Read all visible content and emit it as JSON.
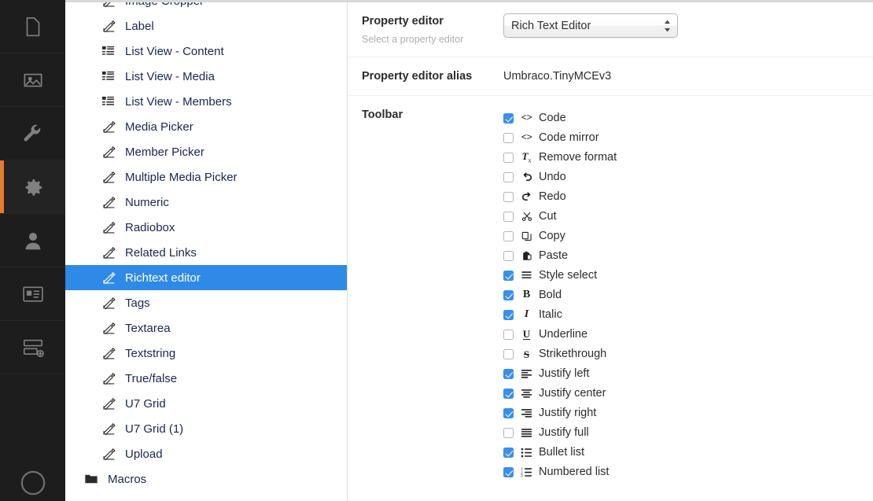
{
  "rail": {
    "items": [
      {
        "name": "content",
        "icon": "document-icon",
        "active": false
      },
      {
        "name": "media",
        "icon": "image-icon",
        "active": false
      },
      {
        "name": "settings-developer",
        "icon": "wrench-icon",
        "active": false
      },
      {
        "name": "settings",
        "icon": "gear-icon",
        "active": true
      },
      {
        "name": "users",
        "icon": "user-icon",
        "active": false
      },
      {
        "name": "members",
        "icon": "member-card-icon",
        "active": false
      },
      {
        "name": "forms",
        "icon": "forms-icon",
        "active": false
      }
    ],
    "bottom": {
      "name": "help",
      "icon": "help-circle-icon"
    },
    "active_indicator_color": "#e8792e"
  },
  "tree": {
    "selected": "Richtext editor",
    "selected_color": "#2e8ae6",
    "items": [
      {
        "label": "Image Cropper",
        "icon": "property-editor-icon",
        "type": "editor"
      },
      {
        "label": "Label",
        "icon": "property-editor-icon",
        "type": "editor"
      },
      {
        "label": "List View - Content",
        "icon": "list-view-icon",
        "type": "listview"
      },
      {
        "label": "List View - Media",
        "icon": "list-view-icon",
        "type": "listview"
      },
      {
        "label": "List View - Members",
        "icon": "list-view-icon",
        "type": "listview"
      },
      {
        "label": "Media Picker",
        "icon": "property-editor-icon",
        "type": "editor"
      },
      {
        "label": "Member Picker",
        "icon": "property-editor-icon",
        "type": "editor"
      },
      {
        "label": "Multiple Media Picker",
        "icon": "property-editor-icon",
        "type": "editor"
      },
      {
        "label": "Numeric",
        "icon": "property-editor-icon",
        "type": "editor"
      },
      {
        "label": "Radiobox",
        "icon": "property-editor-icon",
        "type": "editor"
      },
      {
        "label": "Related Links",
        "icon": "property-editor-icon",
        "type": "editor"
      },
      {
        "label": "Richtext editor",
        "icon": "property-editor-icon",
        "type": "editor"
      },
      {
        "label": "Tags",
        "icon": "property-editor-icon",
        "type": "editor"
      },
      {
        "label": "Textarea",
        "icon": "property-editor-icon",
        "type": "editor"
      },
      {
        "label": "Textstring",
        "icon": "property-editor-icon",
        "type": "editor"
      },
      {
        "label": "True/false",
        "icon": "property-editor-icon",
        "type": "editor"
      },
      {
        "label": "U7 Grid",
        "icon": "property-editor-icon",
        "type": "editor"
      },
      {
        "label": "U7 Grid (1)",
        "icon": "property-editor-icon",
        "type": "editor"
      },
      {
        "label": "Upload",
        "icon": "property-editor-icon",
        "type": "editor"
      },
      {
        "label": "Macros",
        "icon": "folder-icon",
        "type": "folder"
      }
    ]
  },
  "editor": {
    "property_editor": {
      "title": "Property editor",
      "description": "Select a property editor",
      "selected": "Rich Text Editor",
      "options": [
        "Rich Text Editor"
      ]
    },
    "alias": {
      "title": "Property editor alias",
      "value": "Umbraco.TinyMCEv3"
    },
    "toolbar": {
      "title": "Toolbar",
      "checked_color": "#3a8fea",
      "items": [
        {
          "label": "Code",
          "icon": "code-icon",
          "checked": true
        },
        {
          "label": "Code mirror",
          "icon": "code-icon",
          "checked": false
        },
        {
          "label": "Remove format",
          "icon": "remove-format-icon",
          "checked": false
        },
        {
          "label": "Undo",
          "icon": "undo-icon",
          "checked": false
        },
        {
          "label": "Redo",
          "icon": "redo-icon",
          "checked": false
        },
        {
          "label": "Cut",
          "icon": "scissors-icon",
          "checked": false
        },
        {
          "label": "Copy",
          "icon": "copy-icon",
          "checked": false
        },
        {
          "label": "Paste",
          "icon": "paste-icon",
          "checked": false
        },
        {
          "label": "Style select",
          "icon": "style-select-icon",
          "checked": true
        },
        {
          "label": "Bold",
          "icon": "bold-icon",
          "checked": true
        },
        {
          "label": "Italic",
          "icon": "italic-icon",
          "checked": true
        },
        {
          "label": "Underline",
          "icon": "underline-icon",
          "checked": false
        },
        {
          "label": "Strikethrough",
          "icon": "strikethrough-icon",
          "checked": false
        },
        {
          "label": "Justify left",
          "icon": "align-left-icon",
          "checked": true
        },
        {
          "label": "Justify center",
          "icon": "align-center-icon",
          "checked": true
        },
        {
          "label": "Justify right",
          "icon": "align-right-icon",
          "checked": true
        },
        {
          "label": "Justify full",
          "icon": "align-justify-icon",
          "checked": false
        },
        {
          "label": "Bullet list",
          "icon": "bullet-list-icon",
          "checked": true
        },
        {
          "label": "Numbered list",
          "icon": "numbered-list-icon",
          "checked": true
        }
      ]
    }
  }
}
